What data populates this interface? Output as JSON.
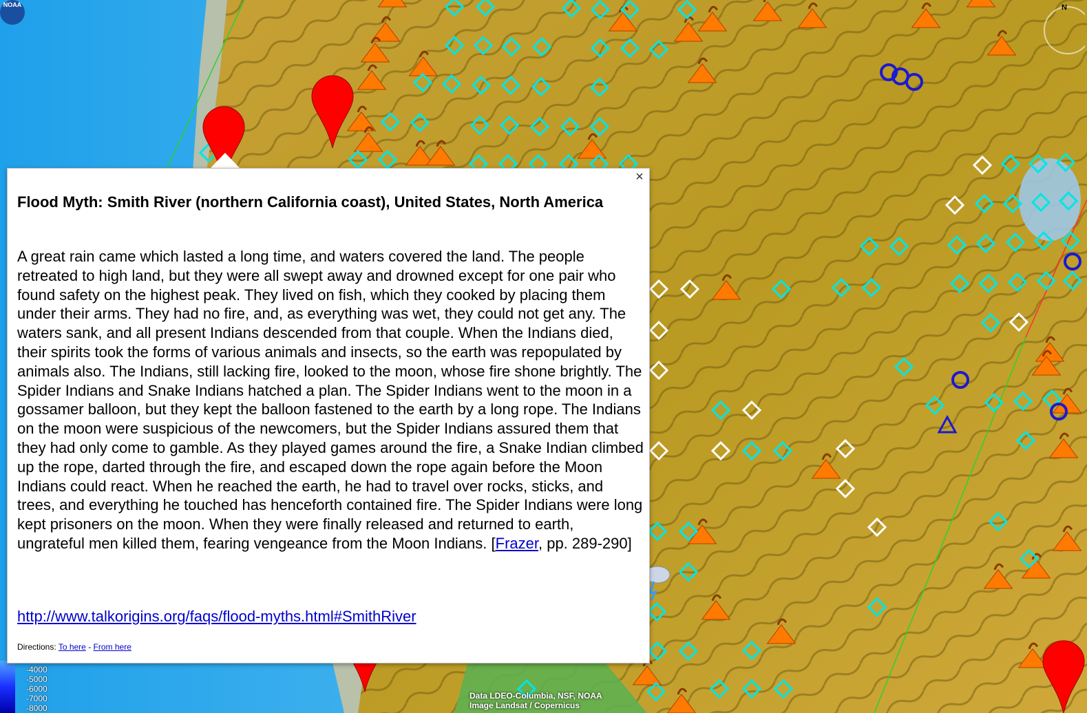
{
  "popup": {
    "title": "Flood Myth: Smith River (northern California coast), United States, North America",
    "body_before_link": "A great rain came which lasted a long time, and waters covered the land. The people retreated to high land, but they were all swept away and drowned except for one pair who found safety on the highest peak. They lived on fish, which they cooked by placing them under their arms. They had no fire, and, as everything was wet, they could not get any. The waters sank, and all present Indians descended from that couple. When the Indians died, their spirits took the forms of various animals and insects, so the earth was repopulated by animals also. The Indians, still lacking fire, looked to the moon, whose fire shone brightly. The Spider Indians and Snake Indians hatched a plan. The Spider Indians went to the moon in a gossamer balloon, but they kept the balloon fastened to the earth by a long rope. The Indians on the moon were suspicious of the newcomers, but the Spider Indians assured them that they had only come to gamble. As they played games around the fire, a Snake Indian climbed up the rope, darted through the fire, and escaped down the rope again before the Moon Indians could react. When he reached the earth, he had to travel over rocks, sticks, and trees, and everything he touched has henceforth contained fire. The Spider Indians were long kept prisoners on the moon. When they were finally released and returned to earth, ungrateful men killed them, fearing vengeance from the Moon Indians. [",
    "citation_link": "Frazer",
    "body_after_link": ", pp. 289-290]",
    "url": "http://www.talkorigins.org/faqs/flood-myths.html#SmithRiver",
    "directions_label": "Directions:",
    "to_here": "To here",
    "separator": "-",
    "from_here": "From here",
    "close_glyph": "×"
  },
  "legend": {
    "values": [
      "-4000",
      "-5000",
      "-6000",
      "-7000",
      "-8000"
    ]
  },
  "attribution": {
    "line1": "Data LDEO-Columbia, NSF, NOAA",
    "line2": "Image Landsat / Copernicus"
  },
  "logo": {
    "text": "NOAA"
  },
  "compass": {
    "north": "N"
  },
  "colors": {
    "ocean": "#2a8fd8",
    "land": "#c9a227",
    "volcano": "#ff7a00",
    "diamond_cyan": "#00e5e5",
    "pin": "#ff0000",
    "circle": "#1a1ad0"
  },
  "markers": {
    "icon_types": [
      "volcano-icon",
      "diamond-cyan-icon",
      "diamond-white-icon",
      "red-pin-icon",
      "blue-circle-icon",
      "blue-triangle-icon",
      "storm-cloud-icon"
    ]
  }
}
